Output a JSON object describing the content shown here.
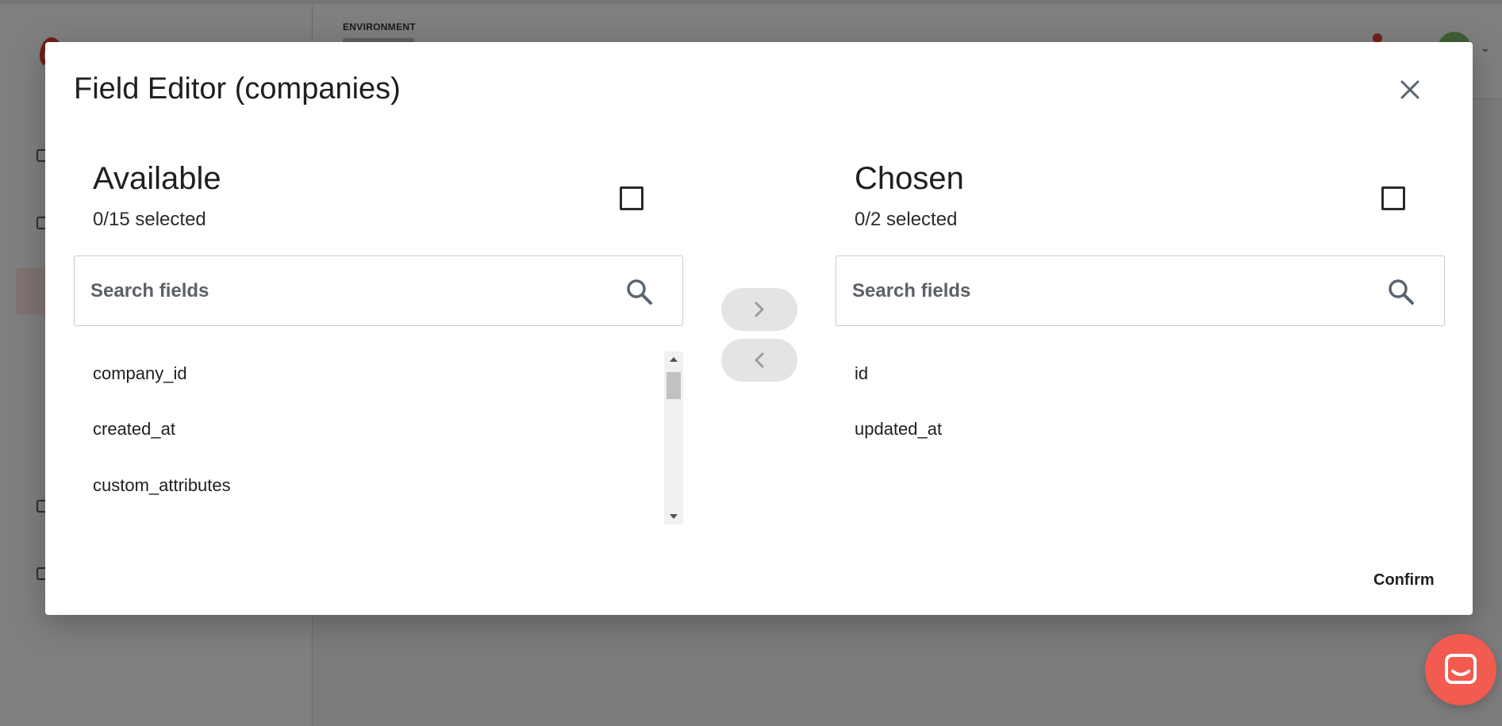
{
  "background": {
    "environment_label": "ENVIRONMENT"
  },
  "modal": {
    "title": "Field Editor (companies)",
    "confirm_label": "Confirm",
    "available": {
      "title": "Available",
      "count": "0/15 selected",
      "search_placeholder": "Search fields",
      "items": [
        "company_id",
        "created_at",
        "custom_attributes"
      ]
    },
    "chosen": {
      "title": "Chosen",
      "count": "0/2 selected",
      "search_placeholder": "Search fields",
      "items": [
        "id",
        "updated_at"
      ]
    },
    "move_right_icon": "chevron-right-icon",
    "move_left_icon": "chevron-left-icon"
  },
  "colors": {
    "accent": "#e1432e",
    "chat_launcher": "#f25b4f",
    "move_button_bg": "#e4e4e4",
    "overlay": "rgba(0,0,0,0.5)"
  }
}
